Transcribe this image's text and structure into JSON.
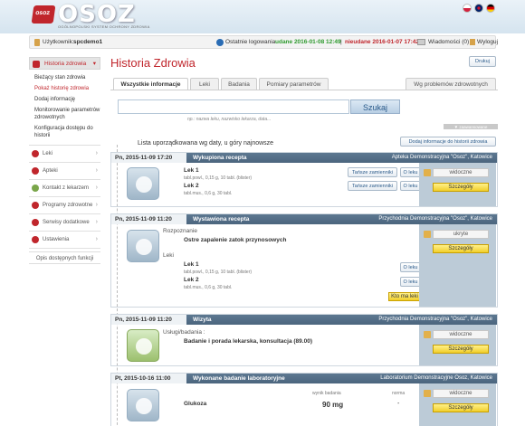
{
  "header": {
    "logo_badge": "OSOZ",
    "logo_text": "OSOZ",
    "logo_subtitle": "OGÓLNOPOLSKI SYSTEM OCHRONY ZDROWIA",
    "flags": [
      "pl-flag",
      "uk-flag",
      "de-flag"
    ]
  },
  "userbar": {
    "user_label": "Użytkownik:",
    "user_name": "spcdemo1",
    "last_login_label": "Ostatnie logowania",
    "success_label": "udane 2016-01-08 12:49",
    "separator": "|",
    "fail_label": "nieudane 2016-01-07 17:42",
    "messages_label": "Wiadomości (0)",
    "logout_label": "Wyloguj"
  },
  "sidebar": {
    "section_title": "Historia zdrowia",
    "sub_items": [
      "Bieżący stan zdrowia",
      "Pokaż historię zdrowia",
      "Dodaj informację",
      "Monitorowanie parametrów zdrowotnych",
      "Konfiguracja dostępu do historii"
    ],
    "items": [
      "Leki",
      "Apteki",
      "Kontakt z lekarzem",
      "Programy zdrowotne",
      "Serwisy dodatkowe",
      "Ustawienia"
    ],
    "help_label": "Opis dostępnych funkcji"
  },
  "main": {
    "title": "Historia Zdrowia",
    "print_label": "Drukuj",
    "tabs": [
      "Wszystkie informacje",
      "Leki",
      "Badania",
      "Pomiary parametrów"
    ],
    "tab_right": "Wg problemów zdrowotnych",
    "search_button": "Szukaj",
    "search_hint": "np.: nazwa leku, nazwisko lekarza, data...",
    "advanced_label": "▼ zaawansowane",
    "list_title": "Lista uporządkowana wg daty, u góry najnowsze",
    "add_info_label": "Dodaj informacje do historii zdrowia"
  },
  "cards": [
    {
      "datetime": "Pn, 2015-11-09 17:20",
      "type": "Wykupiona recepta",
      "location": "Apteka Demonstracyjna \"Osoz\", Katowice",
      "icon": "pills-icon",
      "drugs": [
        {
          "name": "Lek 1",
          "desc": "tabl.powl., 0,15 g, 10 tabl. (blister)",
          "cheaper": "Tańsze zamienniki",
          "about": "O leku"
        },
        {
          "name": "Lek 2",
          "desc": "tabl.mus., 0,6 g, 30 tabl.",
          "cheaper": "Tańsze zamienniki",
          "about": "O leku"
        }
      ],
      "visibility": "widoczne",
      "details": "Szczegóły"
    },
    {
      "datetime": "Pn, 2015-11-09 11:20",
      "type": "Wystawiona recepta",
      "location": "Przychodnia Demonstracyjna \"Osoz\", Katowice",
      "icon": "pills-icon",
      "diagnosis_label": "Rozpoznanie",
      "diagnosis": "Ostre zapalenie zatok przynosowych",
      "drugs_label": "Leki",
      "drugs": [
        {
          "name": "Lek 1",
          "desc": "tabl.powl., 0,15 g, 10 tabl. (blister)",
          "about": "O leku"
        },
        {
          "name": "Lek 2",
          "desc": "tabl.mus., 0,6 g, 30 tabl.",
          "about": "O leku"
        }
      ],
      "who_took": "Kto ma leki",
      "visibility": "ukryte",
      "details": "Szczegóły"
    },
    {
      "datetime": "Pn, 2015-11-09 11:20",
      "type": "Wizyta",
      "location": "Przychodnia Demonstracyjna \"Osoz\", Katowice",
      "icon": "doctor-visit-icon",
      "services_label": "Usługi/badania :",
      "service": "Badanie i porada lekarska, konsultacja (89.00)",
      "visibility": "widoczne",
      "details": "Szczegóły"
    },
    {
      "datetime": "Pt, 2015-10-16 11:00",
      "type": "Wykonane badanie laboratoryjne",
      "location": "Laboratorium Demonstracyjne Osoz, Katowice",
      "icon": "lab-flask-icon",
      "result_label": "wynik badania",
      "norm_label": "norma",
      "test": "Glukoza",
      "result": "90 mg",
      "norm": "-",
      "visibility": "widoczne",
      "details": "Szczegóły"
    }
  ],
  "colors": {
    "accent": "#c0262c",
    "header_bar": "#556f88",
    "aside": "#bccbd7",
    "details_button": "#f1cf2a"
  }
}
